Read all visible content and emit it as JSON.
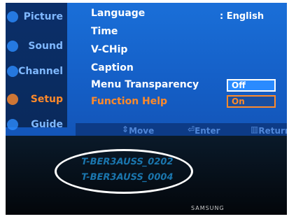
{
  "sidebar": {
    "items": [
      {
        "label": "Picture"
      },
      {
        "label": "Sound"
      },
      {
        "label": "Channel"
      },
      {
        "label": "Setup",
        "active": true
      },
      {
        "label": "Guide"
      }
    ]
  },
  "menu": {
    "rows": [
      {
        "label": "Language",
        "value": "English"
      },
      {
        "label": "Time"
      },
      {
        "label": "V-CHip"
      },
      {
        "label": "Caption"
      },
      {
        "label": "Menu Transparency",
        "value": "Off"
      },
      {
        "label": "Function Help",
        "value": "On"
      }
    ]
  },
  "footer": {
    "move_label": "Move",
    "enter_label": "Enter",
    "return_label": "Return"
  },
  "firmware": {
    "line1": "T-BER3AUSS_0202",
    "line2": "T-BER3AUSS_0004"
  },
  "brand": "SAMSUNG",
  "colors": {
    "osd_blue": "#1a6fd8",
    "highlight_orange": "#ff8a2a",
    "ellipse": "#ffffff"
  }
}
